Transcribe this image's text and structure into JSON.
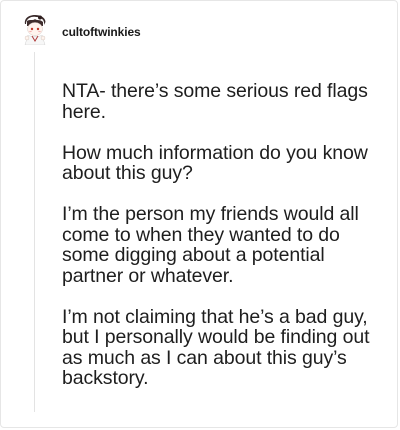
{
  "post": {
    "author": "cultoftwinkies",
    "avatar_icon": "anime-character-avatar-icon",
    "paragraphs": [
      "NTA- there’s some serious red flags here.",
      "How much information do you know about this guy?",
      "I’m the person my friends would all come to when they wanted to do some digging about a potential partner or whatever.",
      "I’m not claiming that he’s a bad guy, but I personally would be finding out as much as I can about this guy’s backstory."
    ]
  }
}
